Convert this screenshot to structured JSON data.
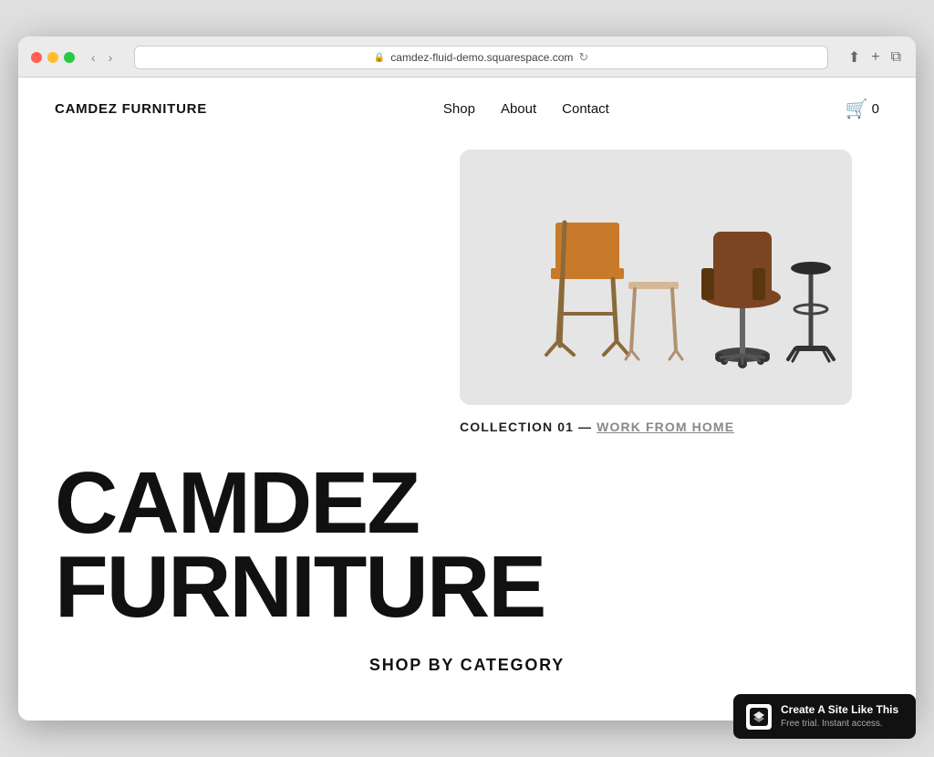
{
  "browser": {
    "url": "camdez-fluid-demo.squarespace.com",
    "reload_icon": "↻"
  },
  "header": {
    "logo": "CAMDEZ FURNITURE",
    "nav": {
      "shop": "Shop",
      "about": "About",
      "contact": "Contact"
    },
    "cart_count": "0"
  },
  "hero": {
    "collection_prefix": "COLLECTION 01 — ",
    "collection_link": "WORK FROM HOME",
    "alt": "Furniture collection image with chairs"
  },
  "headline": "CAMDEZ FURNITURE",
  "shop_category": "SHOP BY CATEGORY",
  "squarespace": {
    "main_text": "Create A Site Like This",
    "sub_text": "Free trial. Instant access."
  }
}
